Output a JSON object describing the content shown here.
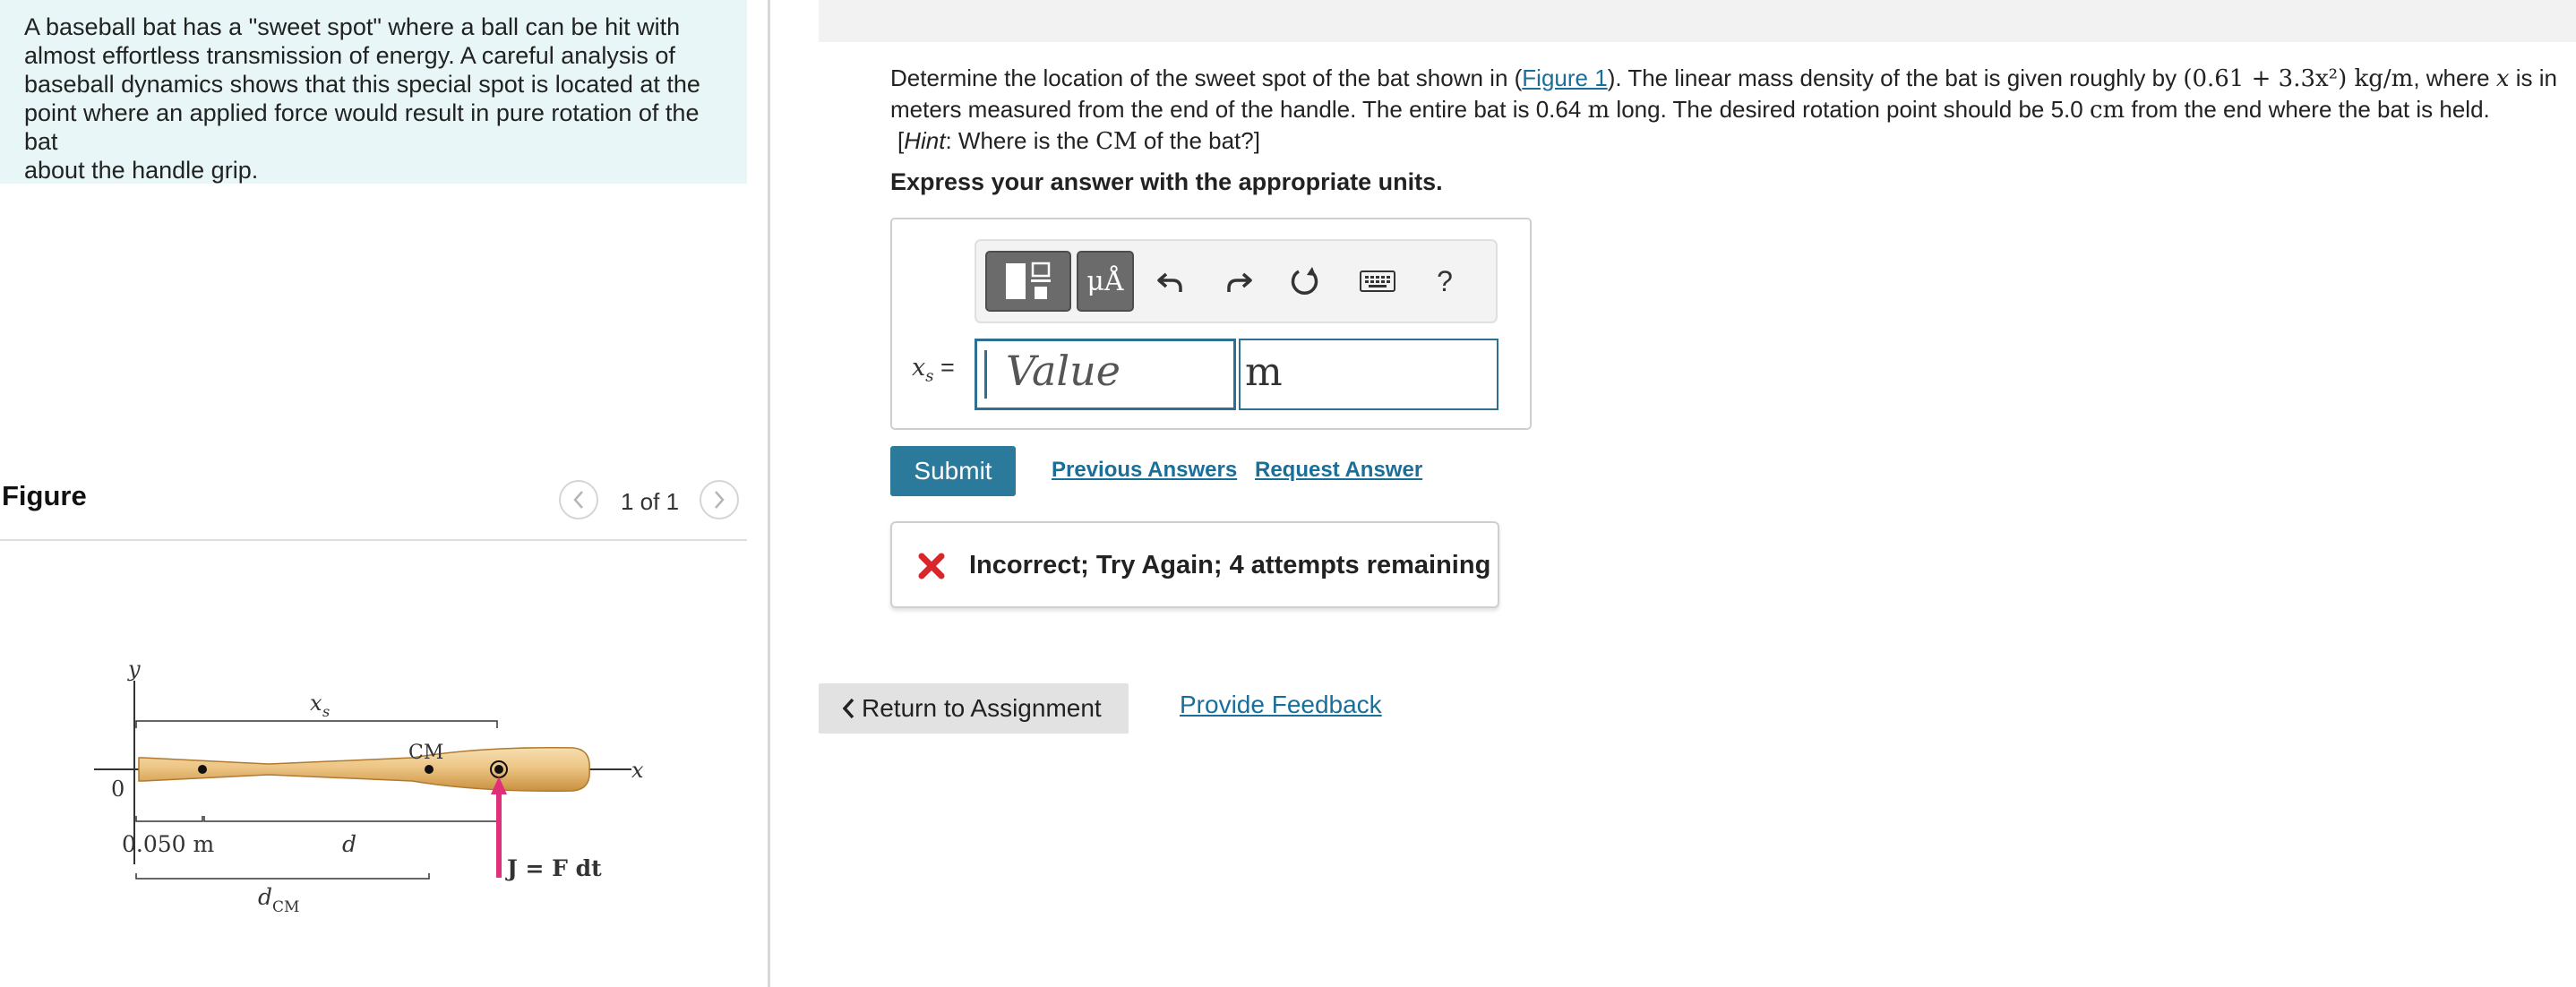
{
  "intro": {
    "lines": [
      "A baseball bat has a \"sweet spot\" where a ball can be hit with",
      "almost effortless transmission of energy. A careful analysis of",
      "baseball dynamics shows that this special spot is located at the",
      "point where an applied force would result in pure rotation of the bat",
      "about the handle grip."
    ]
  },
  "figure": {
    "title": "Figure",
    "pager": "1 of 1",
    "labels": {
      "y": "y",
      "x": "x",
      "origin": "0",
      "xs": "x",
      "xs_sub": "s",
      "cm": "CM",
      "grip": "0.050 m",
      "d": "d",
      "dcm": "d",
      "dcm_sub": "CM",
      "impulse": "J = F dt"
    }
  },
  "question": {
    "part1": "Determine the location of the sweet spot of the bat shown in (",
    "figure_link": "Figure 1",
    "part2": "). The linear mass density of the bat is given roughly by ",
    "density": "(0.61 + 3.3x²) kg/m",
    "part3": ", where ",
    "x_var": "x",
    "part4": " is in meters measured from the end of the handle. The entire bat is 0.64 ",
    "m_unit": "m",
    "part5": " long. The desired rotation point should be 5.0 ",
    "cm_unit": "cm",
    "part6": " from the end where the bat is held.",
    "hint_open": "[",
    "hint_label": "Hint",
    "hint_text": ": Where is the ",
    "hint_cm": "CM",
    "hint_close": " of the bat?]"
  },
  "express": "Express your answer with the appropriate units.",
  "answer": {
    "label_var": "x",
    "label_sub": "s",
    "label_eq": " =",
    "value_placeholder": "Value",
    "unit_value": "m",
    "toolbar": {
      "units_label": "μÅ",
      "help": "?"
    }
  },
  "submit_label": "Submit",
  "previous_answers": "Previous Answers",
  "request_answer": "Request Answer",
  "feedback": {
    "message": "Incorrect; Try Again; 4 attempts remaining",
    "status_color": "#d9262a"
  },
  "return_label": "Return to Assignment",
  "provide_feedback": "Provide Feedback",
  "colors": {
    "accent": "#2b7a9b",
    "link": "#1a6f9a",
    "intro_bg": "#e8f6f7",
    "impulse_arrow": "#e0307a"
  }
}
